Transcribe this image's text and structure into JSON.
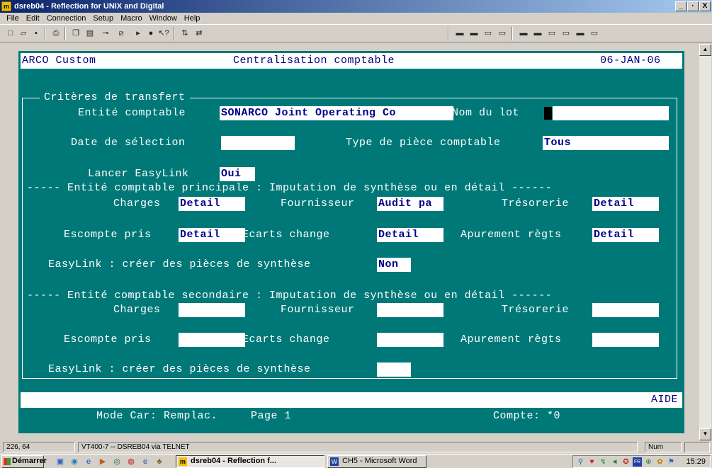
{
  "window": {
    "title": "dsreb04 - Reflection for UNIX and Digital",
    "minimize": "_",
    "maximize": "·",
    "close": "X"
  },
  "menu": [
    "File",
    "Edit",
    "Connection",
    "Setup",
    "Macro",
    "Window",
    "Help"
  ],
  "terminal": {
    "header": {
      "left": "ARCO Custom",
      "center": "Centralisation comptable",
      "right": "06-JAN-06"
    },
    "group_title": "Critères de transfert",
    "entite_label": "Entité comptable",
    "entite_value": "SONARCO Joint Operating Co",
    "nom_lot_label": "Nom du lot",
    "nom_lot_value": "",
    "date_label": "Date de sélection",
    "date_value": "",
    "type_label": "Type de pièce comptable",
    "type_value": "Tous",
    "easylink_label": "Lancer EasyLink",
    "easylink_value": "Oui",
    "principal_section": "----- Entité comptable principale : Imputation de synthèse ou en détail ------",
    "p_charges_label": "Charges",
    "p_charges_value": "Detail",
    "p_fournisseur_label": "Fournisseur",
    "p_fournisseur_value": "Audit pa",
    "p_tresorerie_label": "Trésorerie",
    "p_tresorerie_value": "Detail",
    "p_escompte_label": "Escompte pris",
    "p_escompte_value": "Detail",
    "p_ecarts_label": "Ecarts change",
    "p_ecarts_value": "Detail",
    "p_apurement_label": "Apurement règts",
    "p_apurement_value": "Detail",
    "p_synthese_label": "EasyLink : créer des pièces de synthèse",
    "p_synthese_value": "Non",
    "secondary_section": "----- Entité comptable secondaire : Imputation de synthèse ou en détail ------",
    "s_charges_label": "Charges",
    "s_fournisseur_label": "Fournisseur",
    "s_tresorerie_label": "Trésorerie",
    "s_escompte_label": "Escompte pris",
    "s_ecarts_label": "Ecarts change",
    "s_apurement_label": "Apurement règts",
    "s_synthese_label": "EasyLink : créer des pièces de synthèse",
    "help": "AIDE",
    "mode": "Mode Car: Remplac.",
    "page": "Page 1",
    "compte": "Compte: *0"
  },
  "status": {
    "cursor_pos": "226, 64",
    "connection": "VT400-7 -- DSREB04 via TELNET",
    "num": "Num"
  },
  "taskbar": {
    "start": "Démarrer",
    "task_active": "dsreb04 - Reflection f...",
    "task_word": "CH5 - Microsoft Word",
    "clock": "15:29"
  }
}
